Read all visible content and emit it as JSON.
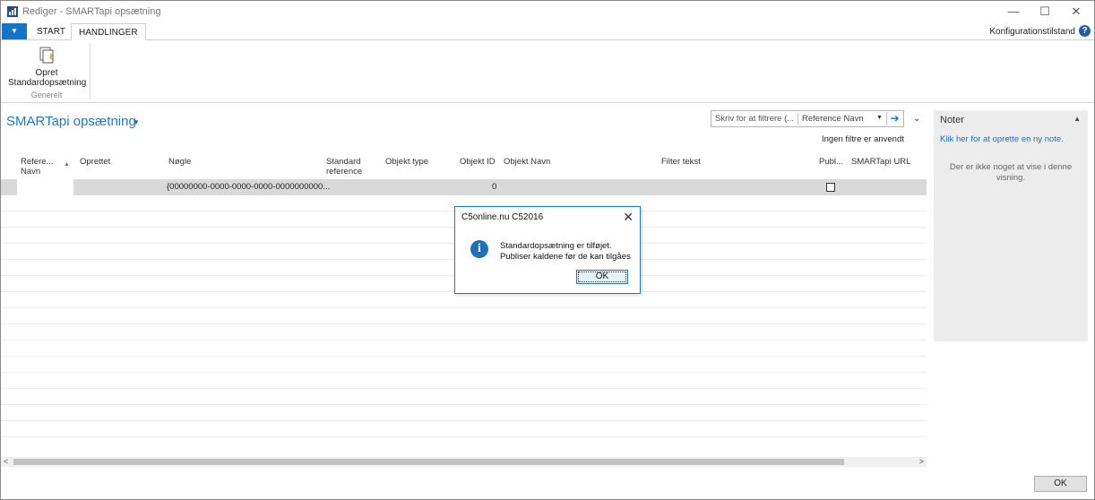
{
  "window": {
    "title": "Rediger - SMARTapi opsætning",
    "minimize": "—",
    "maximize": "☐",
    "close": "✕"
  },
  "ribbon": {
    "menu_glyph": "▼",
    "tabs": [
      {
        "label": "START"
      },
      {
        "label": "HANDLINGER"
      }
    ],
    "config_label": "Konfigurationstilstand",
    "help_glyph": "?",
    "actions": [
      {
        "label_line1": "Opret",
        "label_line2": "Standardopsætning",
        "icon": "document-new-icon"
      }
    ],
    "group_label": "Generelt"
  },
  "page": {
    "title": "SMARTapi opsætning",
    "title_caret": "▼",
    "filter_placeholder": "Skriv for at filtrere (...",
    "filter_field": "Reference Navn",
    "filter_caret": "▼",
    "filter_go": "➔",
    "collapse_glyph": "⌄",
    "filter_status": "Ingen filtre er anvendt"
  },
  "grid": {
    "columns": [
      {
        "line1": "Refere...",
        "line2": "Navn"
      },
      {
        "line1": "Oprettet",
        "line2": ""
      },
      {
        "line1": "Nøgle",
        "line2": ""
      },
      {
        "line1": "Standard",
        "line2": "reference"
      },
      {
        "line1": "Objekt type",
        "line2": ""
      },
      {
        "line1": "Objekt ID",
        "line2": ""
      },
      {
        "line1": "Objekt Navn",
        "line2": ""
      },
      {
        "line1": "Filter tekst",
        "line2": ""
      },
      {
        "line1": "Publ...",
        "line2": ""
      },
      {
        "line1": "SMARTapi URL",
        "line2": ""
      }
    ],
    "sort_glyph": "▲",
    "rows": [
      {
        "key": "{00000000-0000-0000-0000-0000000000...",
        "object_id": "0",
        "published": false
      }
    ],
    "scroll_left": "<",
    "scroll_right": ">"
  },
  "notes": {
    "title": "Noter",
    "caret": "▲",
    "create_link": "Klik her for at oprette en ny note.",
    "empty_line1": "Der er ikke noget at vise i denne",
    "empty_line2": "visning."
  },
  "footer": {
    "ok_label": "OK"
  },
  "dialog": {
    "title": "C5online.nu C52016",
    "close": "✕",
    "info_glyph": "i",
    "message_line1": "Standardopsætning er tilføjet.",
    "message_line2": "Publiser kaldene før de kan tilgåes",
    "ok_label": "OK"
  },
  "colors": {
    "accent": "#1a7acc",
    "menu_button": "#1573c9",
    "selected_row": "#d9d9d9",
    "notes_bg": "#ececec",
    "dialog_border": "#1e7ac4"
  }
}
